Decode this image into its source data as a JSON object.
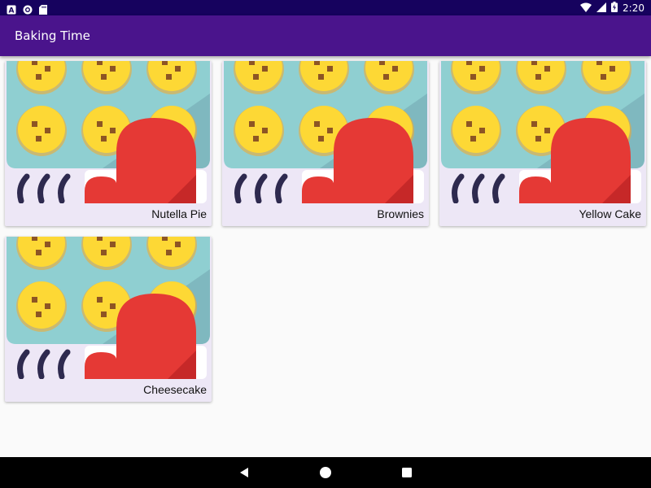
{
  "status_bar": {
    "time": "2:20",
    "left_icons": [
      "text-a-icon",
      "sync-circle-icon",
      "sd-card-icon"
    ],
    "right_icons": [
      "wifi-icon",
      "cell-signal-icon",
      "battery-charging-icon"
    ]
  },
  "app_bar": {
    "title": "Baking Time",
    "color": "#4a148c"
  },
  "recipes": [
    {
      "name": "Nutella Pie",
      "image_icon": "baking-tray-oven-mitt-icon"
    },
    {
      "name": "Brownies",
      "image_icon": "baking-tray-oven-mitt-icon"
    },
    {
      "name": "Yellow Cake",
      "image_icon": "baking-tray-oven-mitt-icon"
    },
    {
      "name": "Cheesecake",
      "image_icon": "baking-tray-oven-mitt-icon"
    }
  ],
  "nav_bar": {
    "buttons": [
      "back-icon",
      "home-icon",
      "recents-icon"
    ]
  },
  "colors": {
    "status_bar": "#16025e",
    "card_background": "#ede7f6",
    "tray": "#8fcfd1",
    "cookie": "#fdd835",
    "mitt": "#e53935"
  }
}
